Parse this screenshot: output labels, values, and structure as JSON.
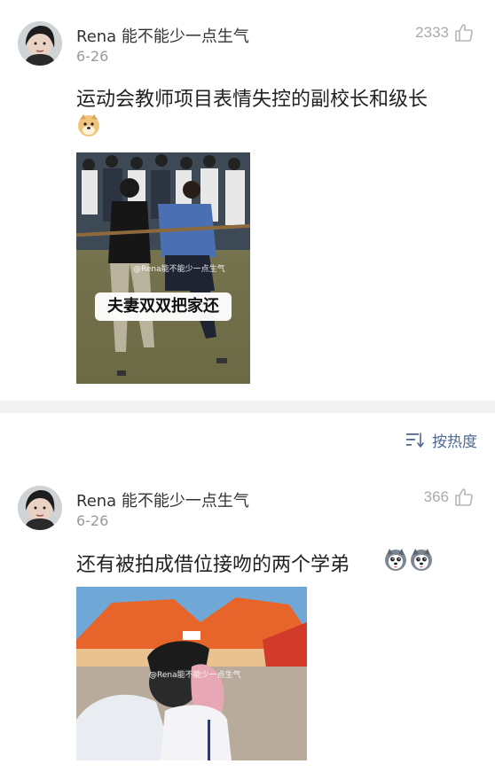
{
  "comments": [
    {
      "username": "Rena 能不能少一点生气",
      "date": "6-26",
      "likes": "2333",
      "text": "运动会教师项目表情失控的副校长和级长",
      "emoji": "doge-emoji",
      "media": {
        "caption": "夫妻双双把家还",
        "watermark": "@Rena能不能少一点生气"
      }
    },
    {
      "username": "Rena 能不能少一点生气",
      "date": "6-26",
      "likes": "366",
      "text": "还有被拍成借位接吻的两个学弟",
      "emoji": "husky-emoji",
      "media": {
        "watermark": "@Rena能不能少一点生气"
      }
    }
  ],
  "sort": {
    "label": "按热度",
    "icon": "sort-icon"
  },
  "colors": {
    "sort_blue": "#4f6a91",
    "muted_gray": "#999999",
    "divider": "#f2f2f2"
  }
}
